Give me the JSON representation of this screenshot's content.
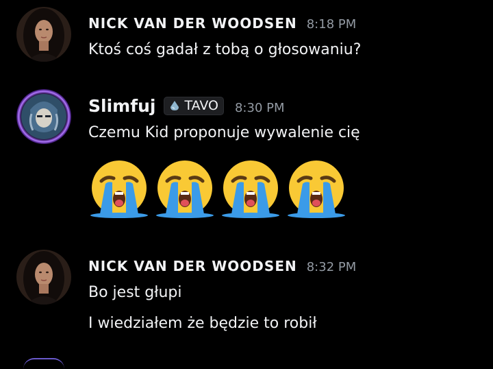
{
  "messages": [
    {
      "author": "NICK VAN DER WOODSEN",
      "time": "8:18 PM",
      "lines": [
        "Ktoś coś gadał z tobą o głosowaniu?"
      ]
    },
    {
      "author": "Slimfuj",
      "tag": "TAVO",
      "time": "8:30 PM",
      "lines": [
        "Czemu Kid proponuje wywalenie cię"
      ],
      "emojis": [
        "loudly-crying-face",
        "loudly-crying-face",
        "loudly-crying-face",
        "loudly-crying-face"
      ]
    },
    {
      "author": "NICK VAN DER WOODSEN",
      "time": "8:32 PM",
      "lines": [
        "Bo jest głupi",
        "I wiedziałem że będzie to robił"
      ]
    }
  ],
  "colors": {
    "background": "#000000",
    "author": "#f2f3f5",
    "timestamp": "#949ba4",
    "emoji_face": "#f9c935",
    "emoji_tears": "#3b9be8",
    "slimfuj_ring": "#8a3cff"
  }
}
